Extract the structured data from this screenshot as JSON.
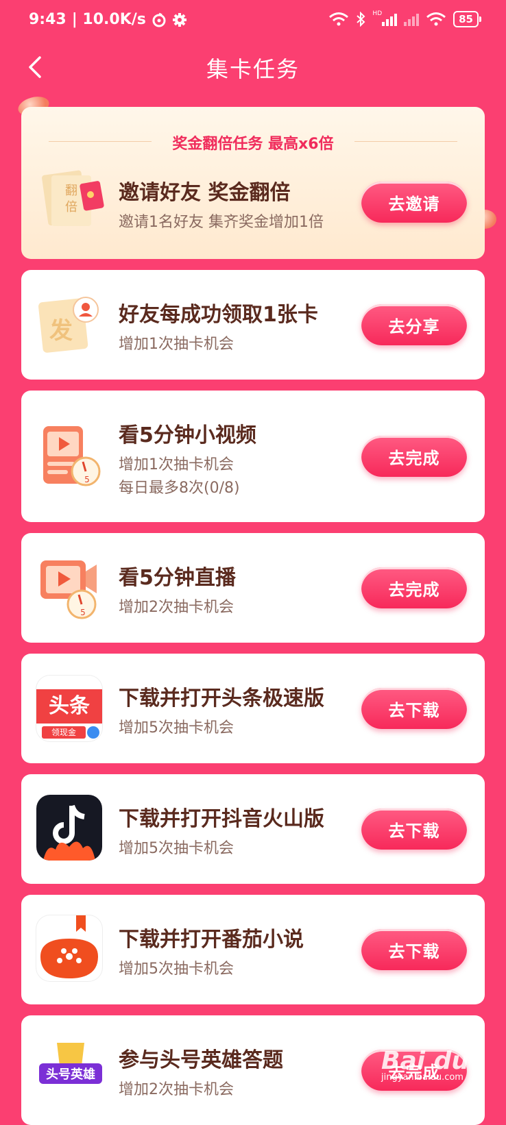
{
  "status_bar": {
    "time": "9:43",
    "speed": "| 10.0K/s",
    "battery": "85",
    "hd": "HD"
  },
  "header": {
    "title": "集卡任务",
    "back_icon": "chevron-left-icon"
  },
  "bonus_card": {
    "heading": "奖金翻倍任务 最高x6倍",
    "title": "邀请好友 奖金翻倍",
    "subtitle": "邀请1名好友 集齐奖金增加1倍",
    "button": "去邀请",
    "icon_text": [
      "翻",
      "倍"
    ]
  },
  "tasks": [
    {
      "title": "好友每成功领取1张卡",
      "subtitle": "增加1次抽卡机会",
      "button": "去分享",
      "icon": "fa-card-icon",
      "icon_text": "发"
    },
    {
      "title": "看5分钟小视频",
      "subtitle": "增加1次抽卡机会",
      "subtitle2": "每日最多8次(0/8)",
      "button": "去完成",
      "icon": "video-timer-icon",
      "icon_text": "5"
    },
    {
      "title": "看5分钟直播",
      "subtitle": "增加2次抽卡机会",
      "button": "去完成",
      "icon": "live-timer-icon",
      "icon_text": "5"
    },
    {
      "title": "下载并打开头条极速版",
      "subtitle": "增加5次抽卡机会",
      "button": "去下载",
      "icon": "toutiao-app-icon",
      "icon_text": "头条",
      "icon_text2": "领现金"
    },
    {
      "title": "下载并打开抖音火山版",
      "subtitle": "增加5次抽卡机会",
      "button": "去下载",
      "icon": "douyin-huoshan-app-icon"
    },
    {
      "title": "下载并打开番茄小说",
      "subtitle": "增加5次抽卡机会",
      "button": "去下载",
      "icon": "fanqie-novel-app-icon"
    },
    {
      "title": "参与头号英雄答题",
      "subtitle": "增加2次抽卡机会",
      "button": "去完成",
      "icon": "hero-quiz-app-icon",
      "icon_text": "头号英雄"
    }
  ],
  "watermark": {
    "text": "Bai du",
    "sub": "jingyan.baidu.com"
  }
}
